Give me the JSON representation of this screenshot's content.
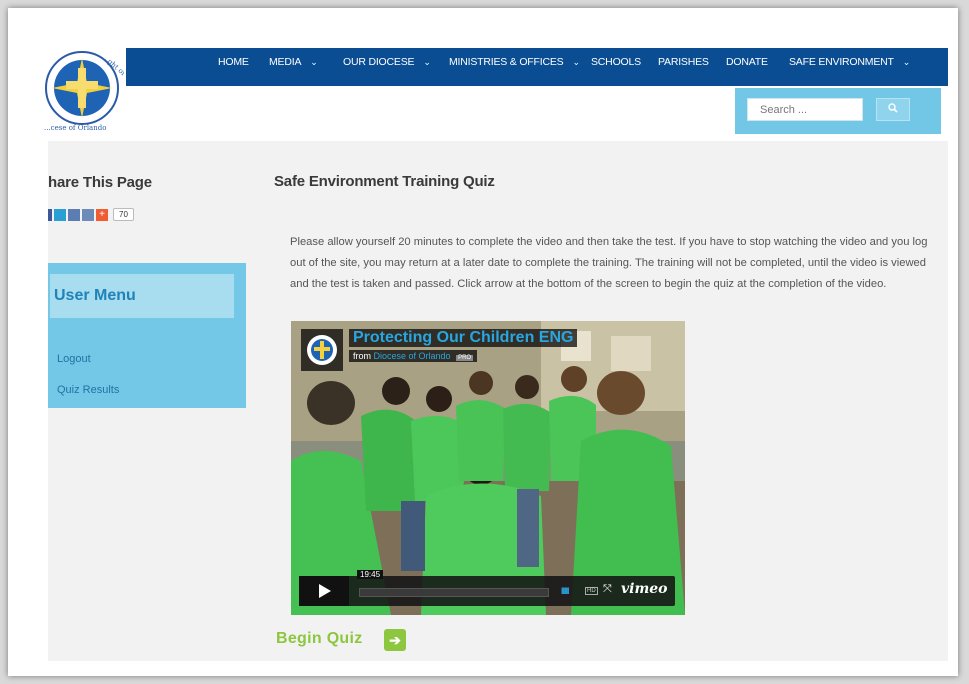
{
  "nav": {
    "items": [
      {
        "label": "HOME",
        "dropdown": false
      },
      {
        "label": "MEDIA",
        "dropdown": true
      },
      {
        "label": "OUR DIOCESE",
        "dropdown": true
      },
      {
        "label": "MINISTRIES & OFFICES",
        "dropdown": true
      },
      {
        "label": "SCHOOLS",
        "dropdown": false
      },
      {
        "label": "PARISHES",
        "dropdown": false
      },
      {
        "label": "DONATE",
        "dropdown": false
      },
      {
        "label": "SAFE ENVIRONMENT",
        "dropdown": true
      }
    ],
    "chevron": "⌄",
    "color": "#0a4d92"
  },
  "logo": {
    "text_top": "...ght of Christ",
    "text_bottom": "...cese of Orlando"
  },
  "search": {
    "placeholder": "Search ...",
    "button_icon": "search-icon"
  },
  "sidebar": {
    "share_title": "hare This Page",
    "share_count": "70",
    "user_menu_title": "User Menu",
    "links": [
      {
        "label": "Logout"
      },
      {
        "label": "Quiz Results"
      }
    ]
  },
  "main": {
    "title": "Safe Environment Training Quiz",
    "intro": "Please allow yourself 20 minutes to complete the video and then take the test. If you have to stop watching the video and you log out of the site, you may return at a later date to complete the training. The training will not be completed, until the video is viewed and the test is taken and passed. Click arrow at the bottom of the screen to begin the quiz at the completion of the video.",
    "begin_label": "Begin Quiz",
    "begin_icon": "➔"
  },
  "video": {
    "title": "Protecting Our Children ENG",
    "from_prefix": "from",
    "author": "Diocese of Orlando",
    "badge": "PRO",
    "time": "19:45",
    "volume": "IIIII",
    "hd": "HD",
    "fullscreen": "⤧",
    "brand": "vimeo",
    "progress": 0.0,
    "accent": "#29a6e0"
  },
  "colors": {
    "light_blue": "#72c8e6",
    "green": "#8dc63f",
    "dark_blue": "#0a4d92"
  }
}
